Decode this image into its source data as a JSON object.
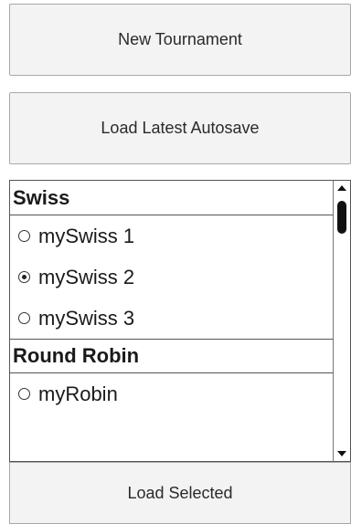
{
  "buttons": {
    "new_tournament": "New Tournament",
    "load_latest_autosave": "Load Latest Autosave",
    "load_selected": "Load Selected"
  },
  "groups": [
    {
      "title": "Swiss",
      "items": [
        {
          "label": "mySwiss 1",
          "selected": false
        },
        {
          "label": "mySwiss 2",
          "selected": true
        },
        {
          "label": "mySwiss 3",
          "selected": false
        }
      ]
    },
    {
      "title": "Round Robin",
      "items": [
        {
          "label": "myRobin",
          "selected": false
        }
      ]
    }
  ],
  "icons": {
    "radio_unchecked": "radio-unchecked-icon",
    "radio_checked": "radio-checked-icon",
    "scroll_up": "scroll-up-arrow-icon",
    "scroll_down": "scroll-down-arrow-icon"
  }
}
